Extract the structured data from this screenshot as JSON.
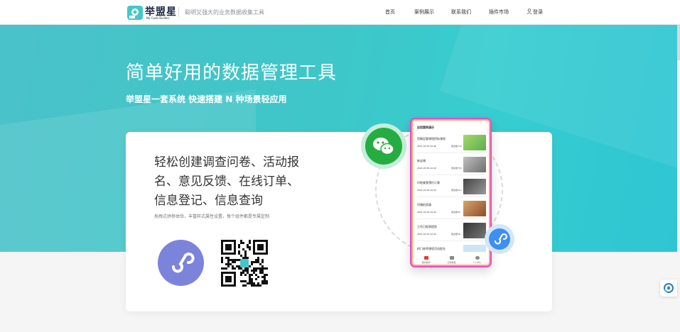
{
  "header": {
    "logo_title": "举盟星",
    "logo_subtitle": "No Code Builder",
    "tagline": "聪明又强大的业务数据收集工具",
    "nav": [
      "首页",
      "案例展示",
      "联系我们",
      "插件市场"
    ],
    "login": "登录"
  },
  "hero": {
    "title": "简单好用的数据管理工具",
    "subtitle": "举盟星一套系统 快速搭建 N 种场景轻应用"
  },
  "card": {
    "title": "轻松创建调查问卷、活动报名、意见反馈、在线订单、信息登记、信息查询",
    "description": "拖拽式拼移体验，丰富样式属性设置，每个组件都是专属定制"
  },
  "phone": {
    "header": "应用案例演示",
    "rows": [
      {
        "title": "您确定要课程招标课程",
        "date": "2021-03-30 10:46",
        "views": "阅读量742"
      },
      {
        "title": "新店铺",
        "date": "2021-03-30 10:43",
        "views": "阅读量789"
      },
      {
        "title": "村地美食预约订餐",
        "date": "2021-03-30 10:43",
        "views": "阅读量41k"
      },
      {
        "title": "村镇拍卖填",
        "date": "2021-03-30 10:44",
        "views": "阅读量89"
      },
      {
        "title": "工作日报表提前",
        "date": "2021-03-30 10:43",
        "views": "阅读量56"
      },
      {
        "title": "树门老师课程活动报名",
        "date": "",
        "views": ""
      }
    ],
    "tabs": [
      "我的案例",
      "应用模板",
      "个人中心"
    ]
  },
  "colors": {
    "hero_start": "#4ac2c9",
    "hero_end": "#2fc5d3",
    "wechat": "#26ad42",
    "mini_program": "#3f8ef1",
    "logo_mark": "#45c7c9"
  },
  "icons": [
    "logo-icon",
    "user-icon",
    "wechat-icon",
    "mini-program-icon",
    "qr-code",
    "chat-widget-icon"
  ]
}
